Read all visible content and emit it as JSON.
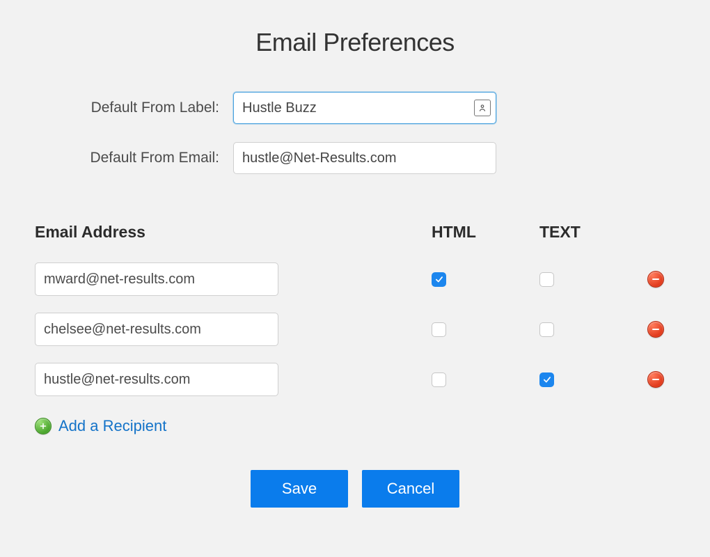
{
  "title": "Email Preferences",
  "defaults": {
    "from_label_label": "Default From Label:",
    "from_label_value": "Hustle Buzz",
    "from_email_label": "Default From Email:",
    "from_email_value": "hustle@Net-Results.com"
  },
  "columns": {
    "email": "Email Address",
    "html": "HTML",
    "text": "TEXT"
  },
  "recipients": [
    {
      "email": "mward@net-results.com",
      "html": true,
      "text": false
    },
    {
      "email": "chelsee@net-results.com",
      "html": false,
      "text": false
    },
    {
      "email": "hustle@net-results.com",
      "html": false,
      "text": true
    }
  ],
  "add_label": "Add a Recipient",
  "actions": {
    "save": "Save",
    "cancel": "Cancel"
  }
}
